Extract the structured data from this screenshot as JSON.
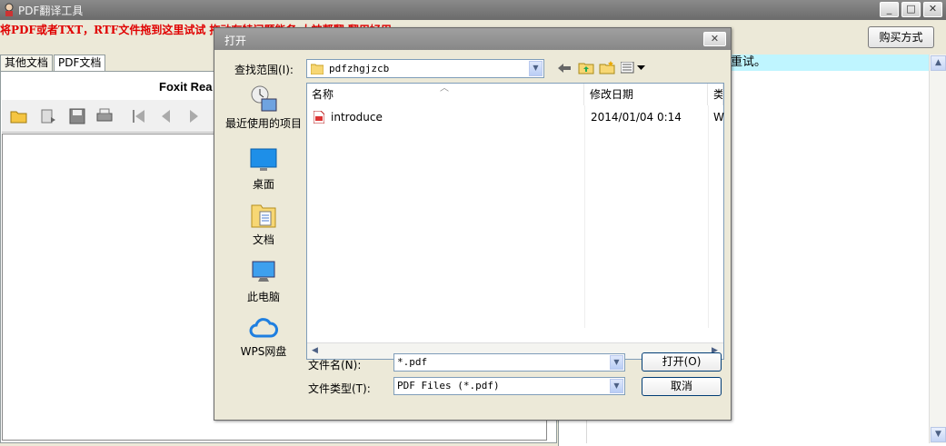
{
  "window": {
    "title": "PDF翻译工具",
    "minimize": "_",
    "maximize": "□",
    "close": "✕"
  },
  "toolbar": {
    "hint": "将PDF或者TXT，RTF文件拖到这里试试  拖动有特问题能务  大神帮翻  翻用好用",
    "buy_label": "购买方式"
  },
  "tabs": [
    "其他文档",
    "PDF文档"
  ],
  "foxit": {
    "title": "Foxit Rea"
  },
  "notice": "重试。",
  "scroll": {
    "up": "▲",
    "down": "▼",
    "left": "◀",
    "right": "▶"
  },
  "dialog": {
    "title": "打开",
    "close": "✕",
    "lookin_label": "查找范围(I):",
    "lookin_value": "pdfzhgjzcb",
    "places": [
      {
        "label": "最近使用的项目"
      },
      {
        "label": "桌面"
      },
      {
        "label": "文档"
      },
      {
        "label": "此电脑"
      },
      {
        "label": "WPS网盘"
      }
    ],
    "columns": {
      "name": "名称",
      "modified": "修改日期",
      "type": "类"
    },
    "files": [
      {
        "name": "introduce",
        "modified": "2014/01/04 0:14",
        "type": "W"
      }
    ],
    "filename_label": "文件名(N):",
    "filename_value": "*.pdf",
    "filetype_label": "文件类型(T):",
    "filetype_value": "PDF Files (*.pdf)",
    "open_label": "打开(O)",
    "cancel_label": "取消"
  },
  "colors": {
    "accent_red": "#e00000",
    "notice_bg": "#bff5ff",
    "title_bar": "#7a7a7a"
  }
}
